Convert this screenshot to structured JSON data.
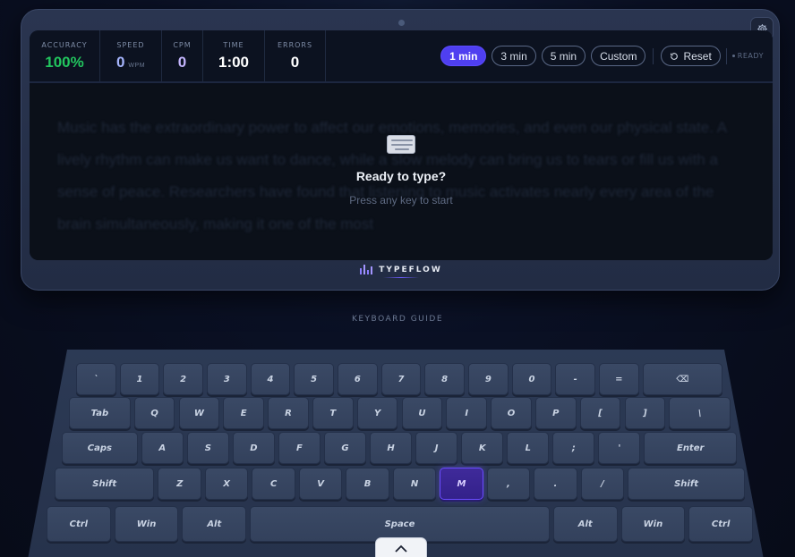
{
  "stats": [
    {
      "label": "ACCURACY",
      "value": "100%",
      "unit": "",
      "color": "#22c55e"
    },
    {
      "label": "SPEED",
      "value": "0",
      "unit": "WPM",
      "color": "#a5b4fc"
    },
    {
      "label": "CPM",
      "value": "0",
      "unit": "",
      "color": "#c4b5fd"
    },
    {
      "label": "TIME",
      "value": "1:00",
      "unit": "",
      "color": "#ffffff"
    },
    {
      "label": "ERRORS",
      "value": "0",
      "unit": "",
      "color": "#ffffff"
    }
  ],
  "controls": {
    "durations": [
      "1 min",
      "3 min",
      "5 min",
      "Custom"
    ],
    "active_duration": "1 min",
    "reset_label": "Reset",
    "reset_icon": "reset-icon",
    "status": "READY"
  },
  "passage": "Music has the extraordinary power to affect our emotions, memories, and even our physical state. A lively rhythm can make us want to dance, while a slow melody can bring us to tears or fill us with a sense of peace. Researchers have found that listening to music activates nearly every area of the brain simultaneously, making it one of the most",
  "overlay": {
    "icon": "keyboard-icon",
    "title": "Ready to type?",
    "subtitle": "Press any key to start"
  },
  "brand": {
    "name": "TYPEFLOW",
    "icon": "bars-chart-icon"
  },
  "settings_icon": "gear-icon",
  "guide_label": "KEYBOARD GUIDE",
  "keyboard": {
    "highlighted": "M",
    "rows": [
      [
        "`",
        "1",
        "2",
        "3",
        "4",
        "5",
        "6",
        "7",
        "8",
        "9",
        "0",
        "-",
        "=",
        "⌫"
      ],
      [
        "Tab",
        "Q",
        "W",
        "E",
        "R",
        "T",
        "Y",
        "U",
        "I",
        "O",
        "P",
        "[",
        "]",
        "\\"
      ],
      [
        "Caps",
        "A",
        "S",
        "D",
        "F",
        "G",
        "H",
        "J",
        "K",
        "L",
        ";",
        "'",
        "Enter"
      ],
      [
        "Shift",
        "Z",
        "X",
        "C",
        "V",
        "B",
        "N",
        "M",
        ",",
        ".",
        "/",
        "Shift"
      ],
      [
        "Ctrl",
        "Win",
        "Alt",
        "Space",
        "Alt",
        "Win",
        "Ctrl"
      ]
    ]
  },
  "collapse_icon": "chevron-up-icon"
}
